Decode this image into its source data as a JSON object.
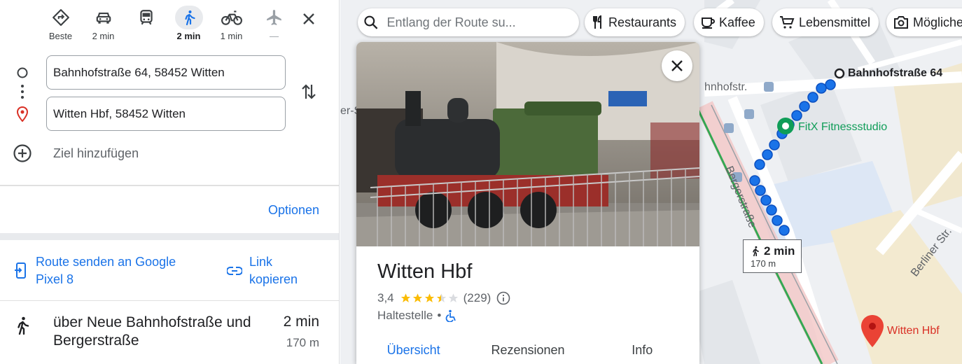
{
  "travel_modes": [
    {
      "name": "best",
      "label": "Beste",
      "active": false
    },
    {
      "name": "car",
      "label": "2 min",
      "active": false
    },
    {
      "name": "transit",
      "label": "",
      "active": false
    },
    {
      "name": "walk",
      "label": "2 min",
      "active": true
    },
    {
      "name": "bicycle",
      "label": "1 min",
      "active": false
    },
    {
      "name": "flight",
      "label": "—",
      "active": false
    }
  ],
  "waypoints": {
    "origin": "Bahnhofstraße 64, 58452 Witten",
    "destination": "Witten Hbf, 58452 Witten",
    "add_destination": "Ziel hinzufügen"
  },
  "options_label": "Optionen",
  "share": {
    "send_to_phone": "Route senden an Google Pixel 8",
    "copy_link": "Link kopieren"
  },
  "route": {
    "via": "über Neue Bahnhofstraße und Bergerstraße",
    "duration": "2 min",
    "distance": "170 m"
  },
  "map": {
    "search_placeholder": "Entlang der Route su...",
    "chips": [
      "Restaurants",
      "Kaffee",
      "Lebensmittel",
      "Mögliche"
    ],
    "labels": {
      "origin": "Bahnhofstraße 64",
      "gym": "FitX Fitnessstudio",
      "destination": "Witten Hbf",
      "street_bahnhofstr": "hnhofstr.",
      "street_berger": "Bergerstraße",
      "street_berliner": "Berliner Str.",
      "street_left_top": "er-Str.",
      "street_left_mid": "er-S"
    },
    "route_tooltip": {
      "duration": "2 min",
      "distance": "170 m"
    },
    "colors": {
      "route": "#1a73e8",
      "pin": "#ea4335",
      "gym": "#0f9d58",
      "rail": "#34a853"
    }
  },
  "place": {
    "name": "Witten Hbf",
    "rating": "3,4",
    "rating_value": 3.4,
    "reviews": "(229)",
    "type": "Haltestelle",
    "tabs": [
      "Übersicht",
      "Rezensionen",
      "Info"
    ]
  }
}
